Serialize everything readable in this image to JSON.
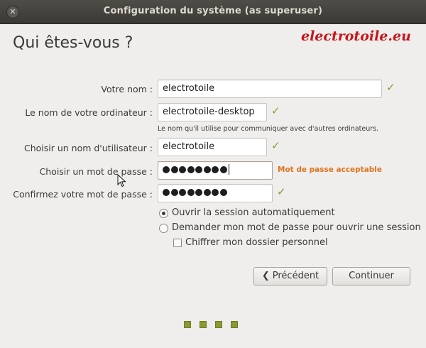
{
  "window": {
    "title": "Configuration du système (as superuser)",
    "close_icon": "close-icon"
  },
  "heading": "Qui êtes-vous ?",
  "watermark": "electrotoile.eu",
  "form": {
    "name_label": "Votre nom :",
    "name_value": "electrotoile",
    "computer_label": "Le nom de votre ordinateur :",
    "computer_value": "electrotoile-desktop",
    "computer_hint": "Le nom qu'il utilise pour communiquer avec d'autres ordinateurs.",
    "username_label": "Choisir un nom d'utilisateur :",
    "username_value": "electrotoile",
    "password_label": "Choisir un mot de passe :",
    "password_length": 8,
    "password_status": "Mot de passe acceptable",
    "confirm_label": "Confirmez votre mot de passe :",
    "confirm_length": 8,
    "check_icon": "check-icon"
  },
  "options": {
    "auto_login": "Ouvrir la session automatiquement",
    "ask_password": "Demander mon mot de passe pour ouvrir une session",
    "encrypt_home": "Chiffrer mon dossier personnel",
    "selected": "auto_login",
    "encrypt_checked": false
  },
  "buttons": {
    "back": "Précédent",
    "continue": "Continuer"
  },
  "progress": {
    "steps": 4
  },
  "colors": {
    "accent_check": "#7ea32a",
    "password_status": "#e0731e",
    "watermark": "#c8141a",
    "progress": "#8a9a2f"
  }
}
